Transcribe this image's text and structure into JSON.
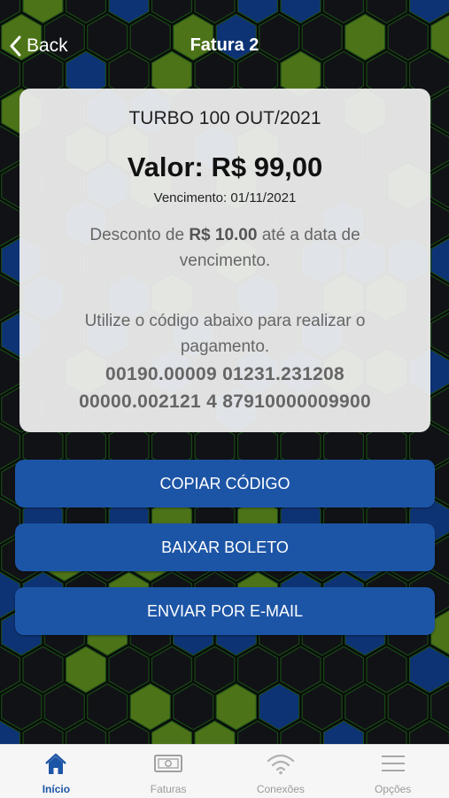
{
  "colors": {
    "accent": "#1d55a6",
    "hex_blue": "#123f8f",
    "hex_green": "#5f8d1f",
    "hex_dark": "#15171b"
  },
  "nav": {
    "back_label": "Back",
    "title": "Fatura 2"
  },
  "invoice": {
    "plan": "TURBO 100 OUT/2021",
    "valor": "Valor: R$ 99,00",
    "vencimento_label": "Vencimento:",
    "vencimento_date": "01/11/2021",
    "desconto_prefix": "Desconto de",
    "desconto_amount": "R$ 10.00",
    "desconto_suffix": "até a data de vencimento.",
    "instruction": "Utilize o código abaixo para realizar o pagamento.",
    "code_line1": "00190.00009 01231.231208",
    "code_line2": "00000.002121 4 87910000009900"
  },
  "actions": {
    "copy": "COPIAR CÓDIGO",
    "download": "BAIXAR BOLETO",
    "email": "ENVIAR POR E-MAIL"
  },
  "tabbar": {
    "items": [
      {
        "label": "Início",
        "icon": "home-icon",
        "active": true
      },
      {
        "label": "Faturas",
        "icon": "banknote-icon",
        "active": false
      },
      {
        "label": "Conexões",
        "icon": "wifi-icon",
        "active": false
      },
      {
        "label": "Opções",
        "icon": "menu-icon",
        "active": false
      }
    ]
  }
}
